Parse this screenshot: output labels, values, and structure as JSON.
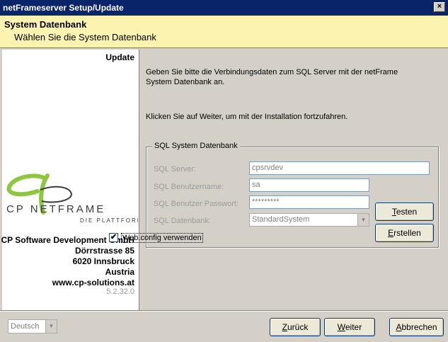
{
  "window": {
    "title": "netFrameserver Setup/Update",
    "close": "×"
  },
  "header": {
    "title": "System Datenbank",
    "subtitle": "Wählen Sie die System Datenbank"
  },
  "left": {
    "mode": "Update",
    "logo": {
      "brand": "CP NETFRAME",
      "tagline": "DIE PLATTFORM"
    },
    "company": {
      "name": "CP Software Development GmbH",
      "street": "Dörrstrasse 85",
      "city": "6020 Innsbruck",
      "country": "Austria",
      "web": "www.cp-solutions.at"
    },
    "version": "5.2.32.0"
  },
  "main": {
    "intro": "Geben Sie bitte die Verbindungsdaten zum SQL Server mit der netFrame System Datenbank an.",
    "continue": "Klicken Sie auf Weiter, um mit der Installation fortzufahren."
  },
  "group": {
    "legend": "SQL System Datenbank",
    "server": {
      "label": "SQL Server:",
      "value": "cpsrvdev"
    },
    "user": {
      "label": "SQL Benutzername:",
      "value": "sa"
    },
    "password": {
      "label": "SQL Benutzer Passwort:",
      "value": "*********"
    },
    "database": {
      "label": "SQL Datenbank:",
      "value": "StandardSystem"
    },
    "webconfig": {
      "label": "Web.config verwenden",
      "checked": "✔"
    },
    "test_first": "T",
    "test_rest": "esten",
    "create_first": "E",
    "create_rest": "rstellen"
  },
  "footer": {
    "language": "Deutsch",
    "back_first": "Z",
    "back_rest": "urück",
    "next_first": "W",
    "next_rest": "eiter",
    "cancel_first": "A",
    "cancel_rest": "bbrechen"
  }
}
